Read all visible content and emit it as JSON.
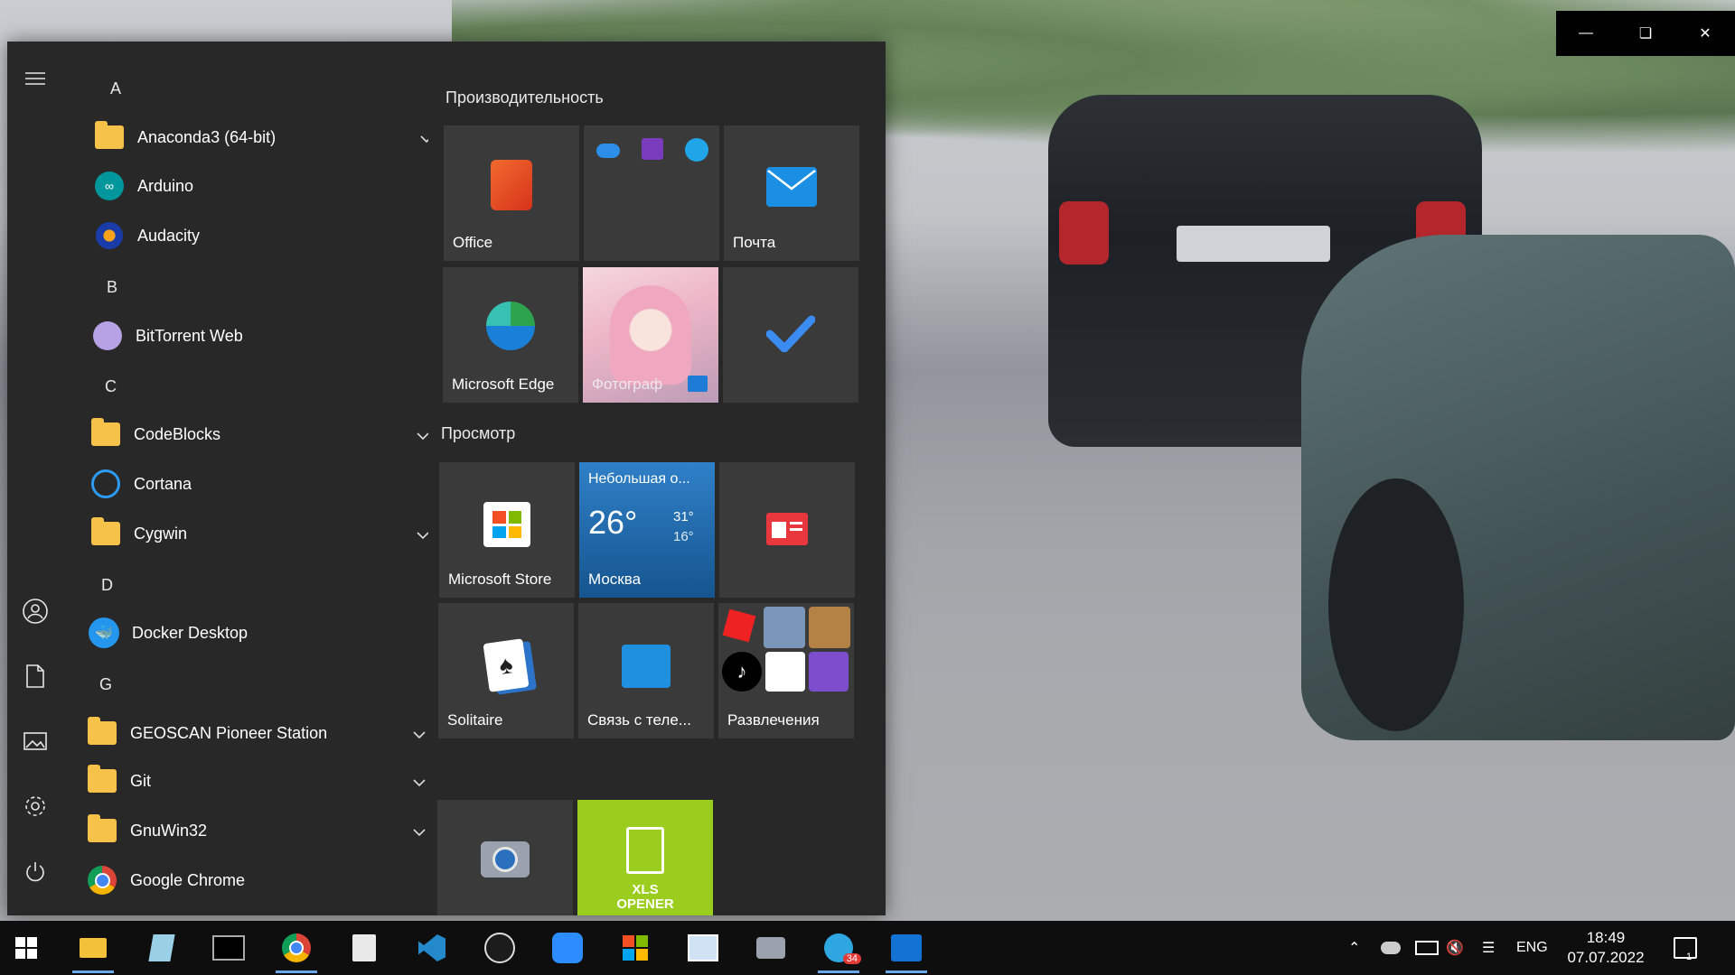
{
  "window": {
    "minimize_icon": "minimize-icon",
    "restore_icon": "restore-icon",
    "close_icon": "close-icon"
  },
  "start_menu": {
    "rail": [
      "hamburger-icon",
      "user-icon",
      "document-icon",
      "pictures-icon",
      "settings-icon",
      "power-icon"
    ],
    "letters": {
      "a": "A",
      "b": "B",
      "c": "C",
      "d": "D",
      "g": "G"
    },
    "apps": {
      "anaconda": "Anaconda3 (64-bit)",
      "arduino": "Arduino",
      "audacity": "Audacity",
      "bittorrent": "BitTorrent Web",
      "codeblocks": "CodeBlocks",
      "cortana": "Cortana",
      "cygwin": "Cygwin",
      "docker": "Docker Desktop",
      "geoscan": "GEOSCAN Pioneer Station",
      "git": "Git",
      "gnuwin": "GnuWin32",
      "chrome": "Google Chrome"
    },
    "groups": {
      "productivity": "Производительность",
      "explore": "Просмотр"
    },
    "tiles": {
      "office": "Office",
      "mail": "Почта",
      "edge": "Microsoft Edge",
      "photos": "Фотограф",
      "store": "Microsoft Store",
      "weather_desc": "Небольшая о...",
      "weather_temp": "26°",
      "weather_hi": "31°",
      "weather_lo": "16°",
      "weather_city": "Москва",
      "solitaire": "Solitaire",
      "phone": "Связь с теле...",
      "entertainment": "Развлечения",
      "xls_line1": "XLS",
      "xls_line2": "OPENER"
    }
  },
  "taskbar": {
    "telegram_badge": "34",
    "lang": "ENG",
    "time": "18:49",
    "date": "07.07.2022",
    "notif_count": "1"
  },
  "colors": {
    "accent": "#6aa7e8",
    "xls_tile": "#9acd1e",
    "weather_tile": "#1d6fb8",
    "start_bg": "#282828"
  }
}
